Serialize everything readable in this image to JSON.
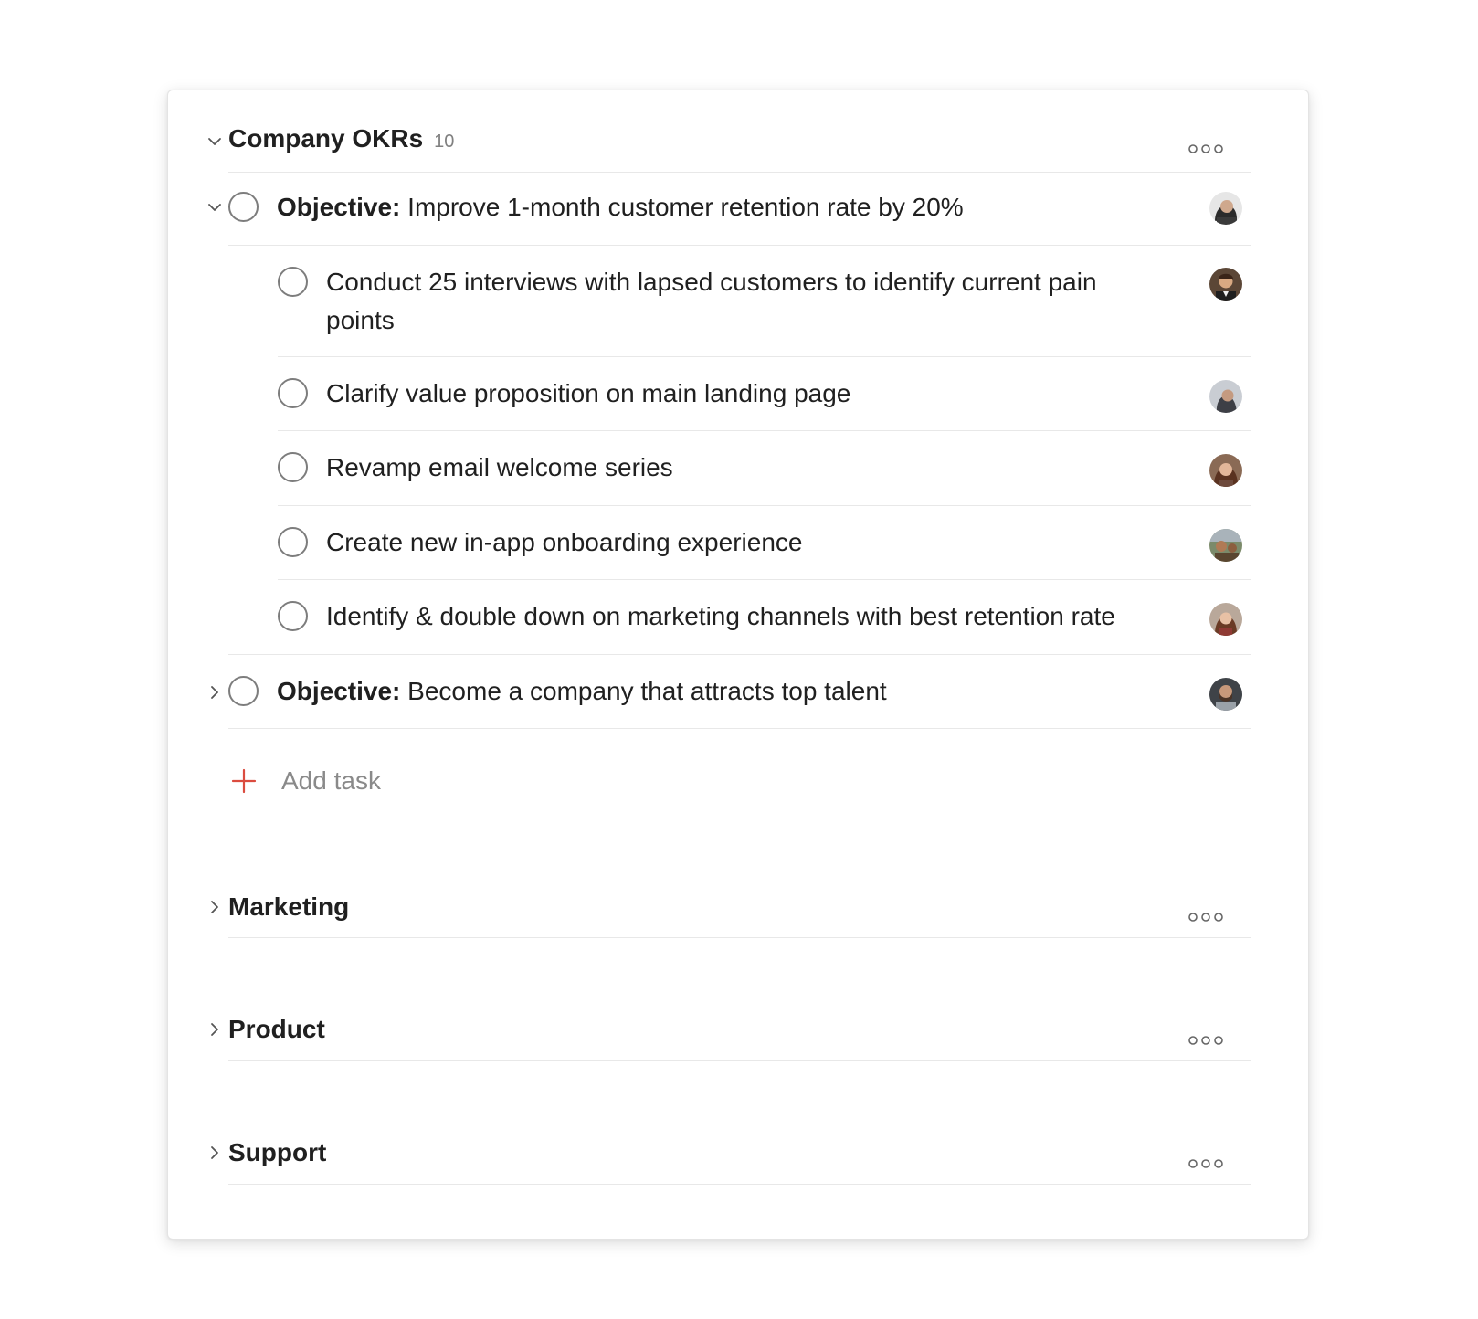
{
  "sections": {
    "okrs": {
      "title": "Company OKRs",
      "count": "10"
    },
    "marketing": {
      "title": "Marketing"
    },
    "product": {
      "title": "Product"
    },
    "support": {
      "title": "Support"
    }
  },
  "objectives": [
    {
      "prefix": "Objective:",
      "text": "Improve 1-month customer retention rate by 20%",
      "expanded": true,
      "avatar": "avatar-woman-dark-hair"
    },
    {
      "prefix": "Objective:",
      "text": "Become a company that attracts top talent",
      "expanded": false,
      "avatar": "avatar-man-beard"
    }
  ],
  "subtasks": [
    {
      "text": "Conduct 25 interviews with lapsed customers to identify current pain points",
      "avatar": "avatar-man-smiling"
    },
    {
      "text": "Clarify value proposition on main landing page",
      "avatar": "avatar-woman-profile"
    },
    {
      "text": "Revamp email welcome series",
      "avatar": "avatar-woman-long-hair"
    },
    {
      "text": "Create new in-app onboarding experience",
      "avatar": "avatar-outdoor-person"
    },
    {
      "text": "Identify & double down on marketing channels with best retention rate",
      "avatar": "avatar-woman-curly-hair"
    }
  ],
  "add_task": {
    "label": "Add task"
  },
  "icons": {
    "expand": "chevron-down-icon",
    "collapse": "chevron-right-icon",
    "more": "more-dots-icon",
    "add": "plus-icon",
    "check": "circle-checkbox-icon"
  },
  "colors": {
    "accent": "#db4c3f",
    "text": "#202020",
    "muted": "#808080",
    "divider": "#e8e8e8"
  }
}
